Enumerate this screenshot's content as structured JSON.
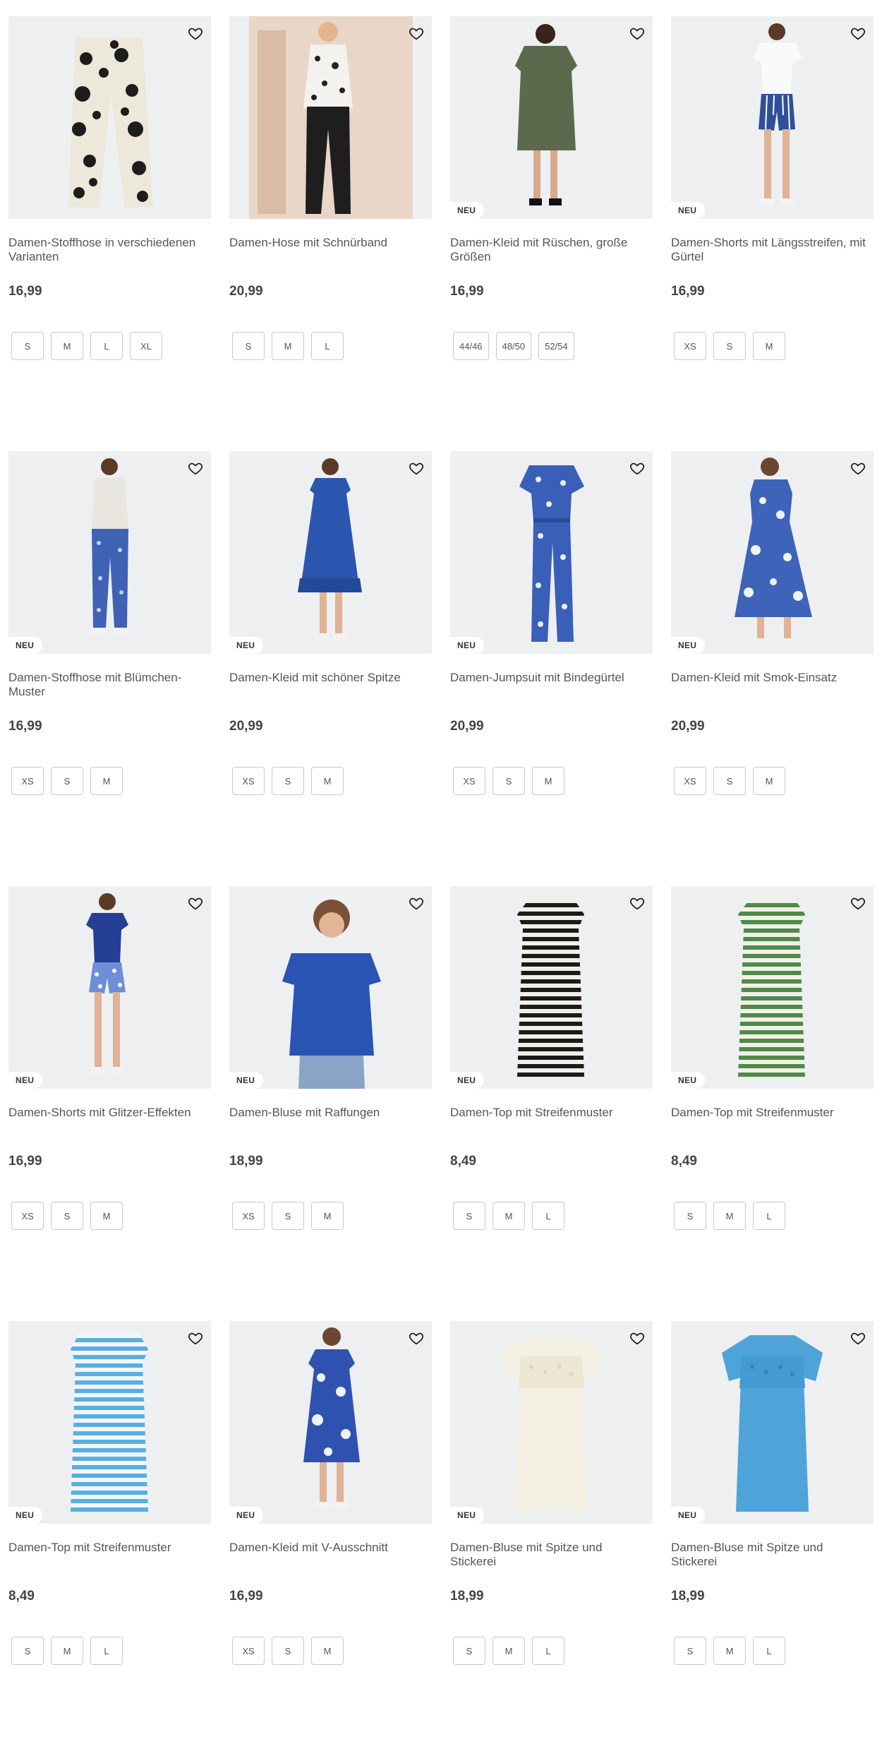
{
  "badge_label": "NEU",
  "icons": {
    "favorite": "heart-outline-icon"
  },
  "colors": {
    "image_bg": "#eeeff1",
    "price_text": "#444444",
    "name_text": "#555555",
    "chip_border": "#c9c9c9"
  },
  "products": [
    {
      "name": "Damen-Stoffhose in verschiedenen Varianten",
      "price": "16,99",
      "is_new": false,
      "sizes": [
        "S",
        "M",
        "L",
        "XL"
      ]
    },
    {
      "name": "Damen-Hose mit Schnürband",
      "price": "20,99",
      "is_new": false,
      "sizes": [
        "S",
        "M",
        "L"
      ]
    },
    {
      "name": "Damen-Kleid mit Rüschen, große Größen",
      "price": "16,99",
      "is_new": true,
      "sizes": [
        "44/46",
        "48/50",
        "52/54"
      ]
    },
    {
      "name": "Damen-Shorts mit Längsstreifen, mit Gürtel",
      "price": "16,99",
      "is_new": true,
      "sizes": [
        "XS",
        "S",
        "M"
      ]
    },
    {
      "name": "Damen-Stoffhose mit Blümchen-Muster",
      "price": "16,99",
      "is_new": true,
      "sizes": [
        "XS",
        "S",
        "M"
      ]
    },
    {
      "name": "Damen-Kleid mit schöner Spitze",
      "price": "20,99",
      "is_new": true,
      "sizes": [
        "XS",
        "S",
        "M"
      ]
    },
    {
      "name": "Damen-Jumpsuit mit Bindegürtel",
      "price": "20,99",
      "is_new": true,
      "sizes": [
        "XS",
        "S",
        "M"
      ]
    },
    {
      "name": "Damen-Kleid mit Smok-Einsatz",
      "price": "20,99",
      "is_new": true,
      "sizes": [
        "XS",
        "S",
        "M"
      ]
    },
    {
      "name": "Damen-Shorts mit Glitzer-Effekten",
      "price": "16,99",
      "is_new": true,
      "sizes": [
        "XS",
        "S",
        "M"
      ]
    },
    {
      "name": "Damen-Bluse mit Raffungen",
      "price": "18,99",
      "is_new": true,
      "sizes": [
        "XS",
        "S",
        "M"
      ]
    },
    {
      "name": "Damen-Top mit Streifenmuster",
      "price": "8,49",
      "is_new": true,
      "sizes": [
        "S",
        "M",
        "L"
      ]
    },
    {
      "name": "Damen-Top mit Streifenmuster",
      "price": "8,49",
      "is_new": true,
      "sizes": [
        "S",
        "M",
        "L"
      ]
    },
    {
      "name": "Damen-Top mit Streifenmuster",
      "price": "8,49",
      "is_new": true,
      "sizes": [
        "S",
        "M",
        "L"
      ]
    },
    {
      "name": "Damen-Kleid mit V-Ausschnitt",
      "price": "16,99",
      "is_new": true,
      "sizes": [
        "XS",
        "S",
        "M"
      ]
    },
    {
      "name": "Damen-Bluse mit Spitze und Stickerei",
      "price": "18,99",
      "is_new": true,
      "sizes": [
        "S",
        "M",
        "L"
      ]
    },
    {
      "name": "Damen-Bluse mit Spitze und Stickerei",
      "price": "18,99",
      "is_new": true,
      "sizes": [
        "S",
        "M",
        "L"
      ]
    }
  ]
}
